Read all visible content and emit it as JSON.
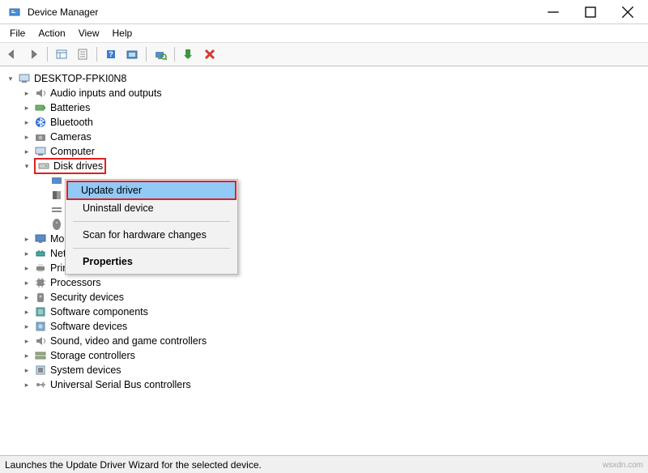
{
  "window": {
    "title": "Device Manager"
  },
  "menubar": [
    "File",
    "Action",
    "View",
    "Help"
  ],
  "tree": {
    "root": "DESKTOP-FPKI0N8",
    "nodes": [
      {
        "label": "Audio inputs and outputs",
        "expanded": false
      },
      {
        "label": "Batteries",
        "expanded": false
      },
      {
        "label": "Bluetooth",
        "expanded": false
      },
      {
        "label": "Cameras",
        "expanded": false
      },
      {
        "label": "Computer",
        "expanded": false
      },
      {
        "label": "Disk drives",
        "expanded": true,
        "highlight": true
      },
      {
        "label": "Monitors",
        "expanded": false
      },
      {
        "label": "Network adapters",
        "expanded": false
      },
      {
        "label": "Print queues",
        "expanded": false
      },
      {
        "label": "Processors",
        "expanded": false
      },
      {
        "label": "Security devices",
        "expanded": false
      },
      {
        "label": "Software components",
        "expanded": false
      },
      {
        "label": "Software devices",
        "expanded": false
      },
      {
        "label": "Sound, video and game controllers",
        "expanded": false
      },
      {
        "label": "Storage controllers",
        "expanded": false
      },
      {
        "label": "System devices",
        "expanded": false
      },
      {
        "label": "Universal Serial Bus controllers",
        "expanded": false
      }
    ]
  },
  "context_menu": {
    "items": [
      {
        "label": "Update driver",
        "selected": true
      },
      {
        "label": "Uninstall device"
      },
      {
        "sep": true
      },
      {
        "label": "Scan for hardware changes"
      },
      {
        "sep": true
      },
      {
        "label": "Properties",
        "bold": true
      }
    ]
  },
  "statusbar": "Launches the Update Driver Wizard for the selected device.",
  "watermark": "wsxdn.com"
}
